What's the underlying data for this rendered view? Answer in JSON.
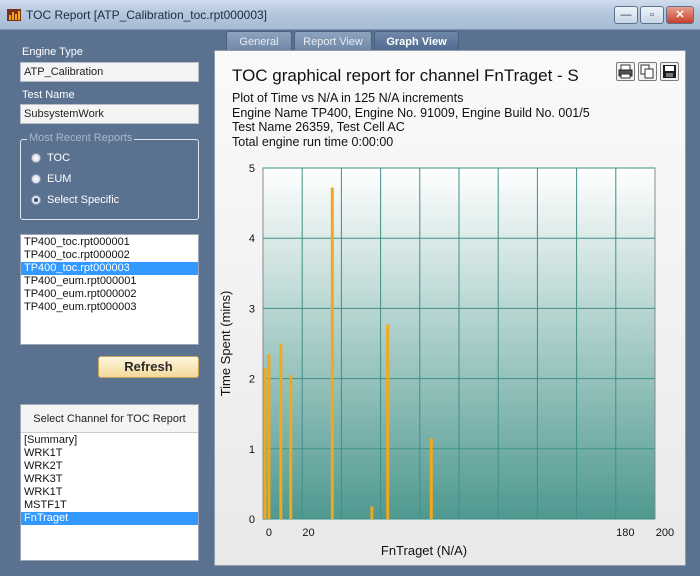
{
  "window": {
    "title": "TOC Report [ATP_Calibration_toc.rpt000003]",
    "min_glyph": "—",
    "max_glyph": "▫",
    "close_glyph": "✕"
  },
  "left": {
    "engine_type_label": "Engine Type",
    "engine_type_value": "ATP_Calibration",
    "test_name_label": "Test Name",
    "test_name_value": "SubsystemWork",
    "recent_title": "Most Recent Reports",
    "radios": [
      {
        "label": "TOC",
        "selected": false
      },
      {
        "label": "EUM",
        "selected": false
      },
      {
        "label": "Select Specific",
        "selected": true
      }
    ],
    "files": [
      "TP400_toc.rpt000001",
      "TP400_toc.rpt000002",
      "TP400_toc.rpt000003",
      "TP400_eum.rpt000001",
      "TP400_eum.rpt000002",
      "TP400_eum.rpt000003"
    ],
    "selected_file": 2,
    "refresh_label": "Refresh",
    "channel_header": "Select Channel for TOC Report",
    "channels": [
      "[Summary]",
      "WRK1T",
      "WRK2T",
      "WRK3T",
      "WRK1T",
      "MSTF1T",
      "FnTraget"
    ],
    "selected_channel": 6
  },
  "tabs": [
    "General",
    "Report View",
    "Graph View"
  ],
  "active_tab": 2,
  "graph": {
    "title": "TOC graphical report for channel FnTraget - S",
    "lines": [
      "Plot of Time vs N/A in 125 N/A increments",
      "Engine Name TP400, Engine No. 91009, Engine Build No. 001/5",
      "Test Name 26359, Test Cell AC",
      "Total engine run time 0:00:00"
    ],
    "toolbar": [
      "print-icon",
      "copy-icon",
      "save-icon"
    ]
  },
  "chart_data": {
    "type": "bar",
    "xlabel": "FnTraget (N/A)",
    "ylabel": "Time Spent (mins)",
    "ylim": [
      0,
      5
    ],
    "y_ticks": [
      0,
      1,
      2,
      3,
      4,
      5
    ],
    "x_tick_labels": [
      "0",
      "20",
      "180",
      "200"
    ],
    "x_tick_values": [
      0,
      20,
      180,
      200
    ],
    "xlim": [
      -3,
      195
    ],
    "bar_color": "#f2a81d",
    "plot_bg_top": "#ffffff",
    "plot_bg_bottom": "#4f9990",
    "grid": true,
    "x": [
      -2,
      0,
      6,
      11,
      32,
      52,
      60,
      82
    ],
    "values": [
      2.15,
      2.35,
      2.5,
      2.05,
      4.72,
      0.18,
      2.77,
      1.15
    ]
  }
}
